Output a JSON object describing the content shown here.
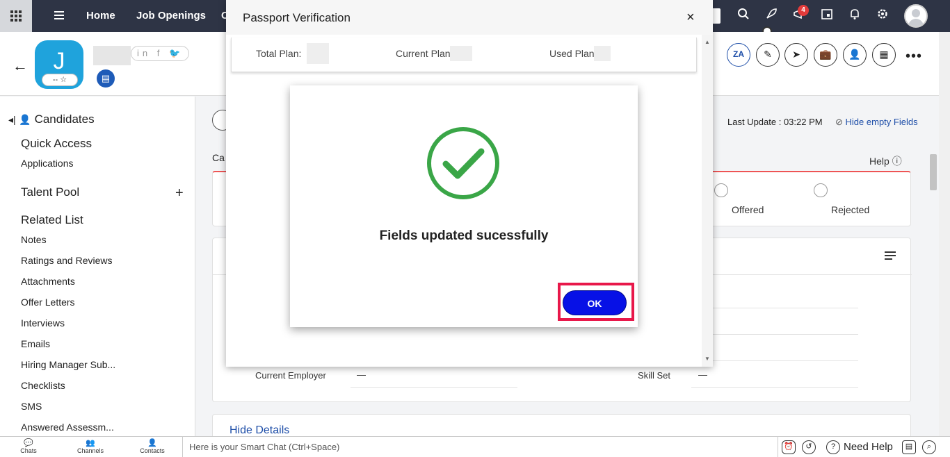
{
  "topnav": {
    "items": [
      "Home",
      "Job Openings",
      "C"
    ],
    "notification_count": "4",
    "icons": [
      "grid-icon",
      "menu-icon",
      "search-icon",
      "rocket-icon",
      "announcement-icon",
      "calendar-icon",
      "bell-icon",
      "gear-icon",
      "profile-avatar"
    ]
  },
  "record": {
    "avatar_letter": "J",
    "rating": "-- ☆",
    "social": "in f 🐦",
    "actions": [
      "translate-icon",
      "edit-note-icon",
      "send-icon",
      "briefcase-icon",
      "assign-user-icon",
      "schedule-icon"
    ],
    "more": "•••"
  },
  "sidebar": {
    "title": "Candidates",
    "quick_access": "Quick Access",
    "applications": "Applications",
    "talent_pool": "Talent Pool",
    "talent_pool_add": "+",
    "related_list": "Related List",
    "links": [
      "Notes",
      "Ratings and Reviews",
      "Attachments",
      "Offer Letters",
      "Interviews",
      "Emails",
      "Hiring Manager Sub...",
      "Checklists",
      "SMS",
      "Answered Assessm..."
    ]
  },
  "main": {
    "last_update": "Last Update : 03:22 PM",
    "hide_empty": "Hide empty Fields",
    "help": "Help",
    "tab_partial": "Ca",
    "stages": [
      "Offered",
      "Rejected"
    ],
    "fields": {
      "current_employer_label": "Current Employer",
      "current_employer_value": "—",
      "skill_set_label": "Skill Set",
      "skill_set_value": "—"
    },
    "hide_details": "Hide Details"
  },
  "bottombar": {
    "chats": "Chats",
    "channels": "Channels",
    "contacts": "Contacts",
    "smart_chat_placeholder": "Here is your Smart Chat (Ctrl+Space)",
    "need_help": "Need Help"
  },
  "modal": {
    "title": "Passport Verification",
    "close": "×",
    "total_plan": "Total Plan: ",
    "current_plan": "Current Plan",
    "used_plan": "Used Plan"
  },
  "success": {
    "message": "Fields updated sucessfully",
    "ok": "OK",
    "check_color": "#3aa647",
    "ok_color": "#0711e6",
    "highlight_color": "#e8184a"
  }
}
